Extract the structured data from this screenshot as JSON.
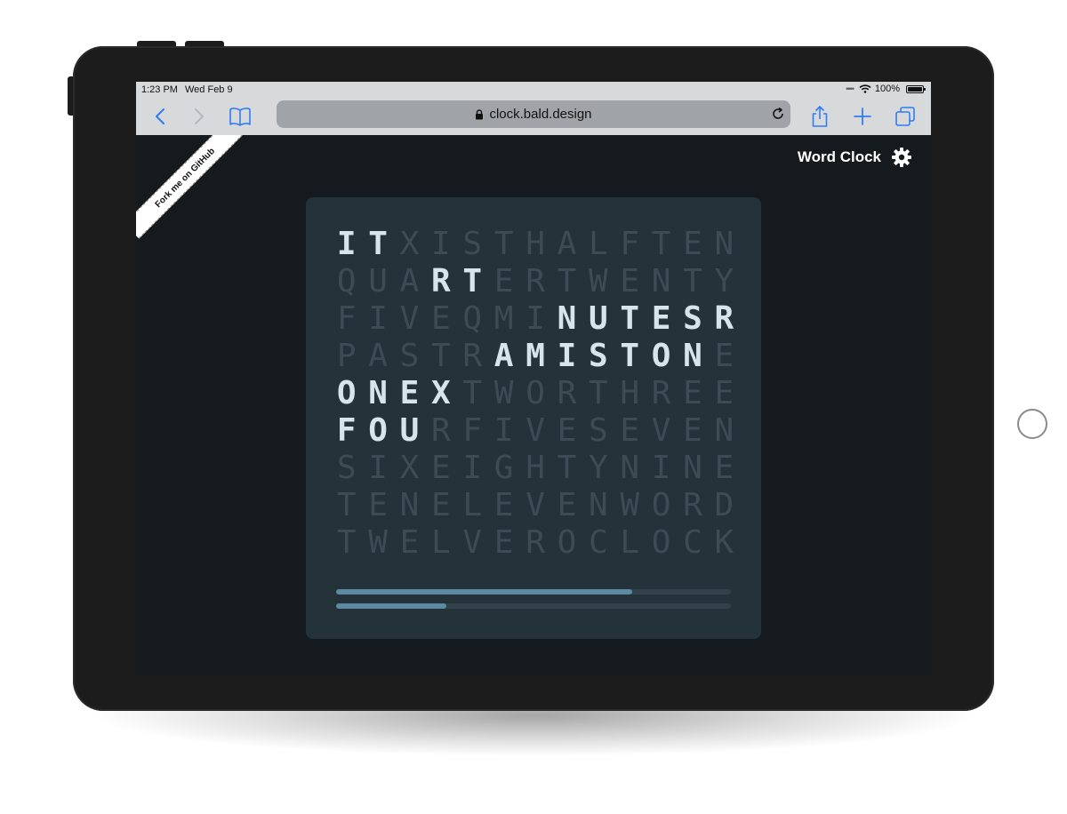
{
  "status_bar": {
    "time": "1:23 PM",
    "date": "Wed Feb 9",
    "battery": "100%"
  },
  "browser": {
    "url": "clock.bald.design"
  },
  "page": {
    "ribbon_text": "Fork me on GitHub",
    "app_title": "Word Clock"
  },
  "clock": {
    "grid": [
      "ITXISTHALFTEN",
      "QUARTERTWENTY",
      "FIVEQMINUTESR",
      "PASTRAMISTONE",
      "ONEXTWORTHREE",
      "FOURFIVESEVEN",
      "SIXEIGHTYNINE",
      "TENELEVENWORD",
      "TWELVEROCLOCK"
    ],
    "lit": [
      [
        0,
        1
      ],
      [
        3,
        4
      ],
      [
        7,
        8,
        9,
        10,
        11,
        12
      ],
      [
        5,
        6,
        7,
        8,
        9,
        10,
        11
      ],
      [
        0,
        1,
        2,
        3
      ],
      [
        0,
        1,
        2
      ],
      [],
      [],
      []
    ],
    "progress": [
      0.75,
      0.28
    ]
  },
  "colors": {
    "page_bg": "#141a1d",
    "card_bg": "#243239",
    "lit_letter": "#d6e4ec",
    "dim_letter": "#3c4c55",
    "progress": "#5b8aa1"
  }
}
